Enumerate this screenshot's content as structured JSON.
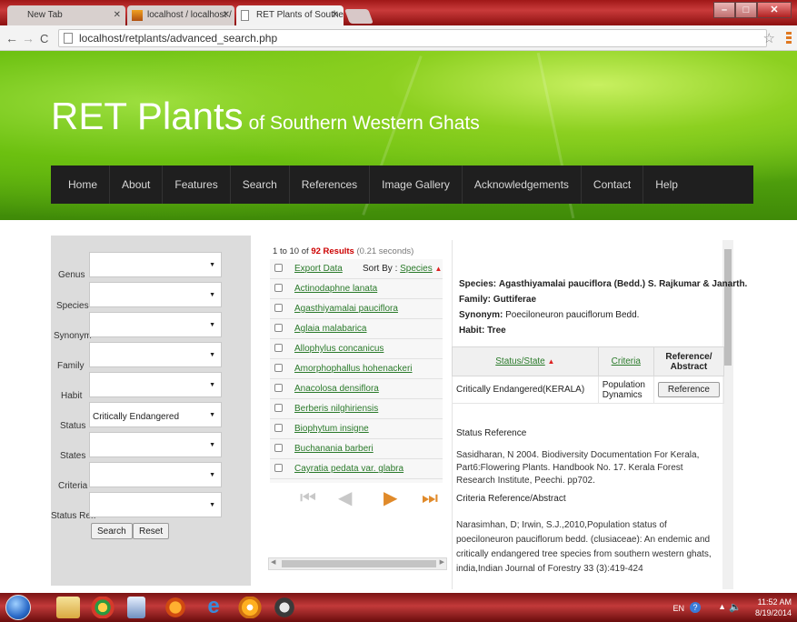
{
  "browser": {
    "tabs": [
      {
        "title": "New Tab"
      },
      {
        "title": "localhost / localhost / retp"
      },
      {
        "title": "RET Plants of Southern We"
      }
    ],
    "url": "localhost/retplants/advanced_search.php"
  },
  "site": {
    "title_big": "RET Plants",
    "title_small": "of Southern Western Ghats",
    "nav": [
      "Home",
      "About",
      "Features",
      "Search",
      "References",
      "Image Gallery",
      "Acknowledgements",
      "Contact",
      "Help"
    ]
  },
  "search": {
    "fields": [
      {
        "label": "Genus",
        "value": ""
      },
      {
        "label": "Species",
        "value": ""
      },
      {
        "label": "Synonym",
        "value": ""
      },
      {
        "label": "Family",
        "value": ""
      },
      {
        "label": "Habit",
        "value": ""
      },
      {
        "label": "Status",
        "value": "Critically Endangered"
      },
      {
        "label": "States",
        "value": ""
      },
      {
        "label": "Criteria",
        "value": ""
      },
      {
        "label": "Status Ref.",
        "value": ""
      }
    ],
    "search_label": "Search",
    "reset_label": "Reset"
  },
  "results": {
    "count_from": "1",
    "count_to_word": "to",
    "count_to": "10",
    "count_of_word": "of",
    "count_total": "92 Results",
    "time": "(0.21 seconds)",
    "export_label": "Export Data",
    "sort_label": "Sort By :",
    "sort_field": "Species",
    "items": [
      "Actinodaphne lanata",
      "Agasthiyamalai pauciflora",
      "Aglaia malabarica",
      "Allophylus concanicus",
      "Amorphophallus hohenackeri",
      "Anacolosa densiflora",
      "Berberis nilghiriensis",
      "Biophytum insigne",
      "Buchanania barberi",
      "Cayratia pedata var. glabra"
    ]
  },
  "detail": {
    "species_label": "Species:",
    "species": "Agasthiyamalai pauciflora (Bedd.) S. Rajkumar & Janarth.",
    "family_label": "Family:",
    "family": "Guttiferae",
    "synonym_label": "Synonym:",
    "synonym": "Poeciloneuron pauciflorum Bedd.",
    "habit_label": "Habit:",
    "habit": "Tree",
    "table_headers": {
      "status": "Status/State",
      "criteria": "Criteria",
      "reference": "Reference/ Abstract"
    },
    "row": {
      "status": "Critically Endangered(KERALA)",
      "criteria": "Population Dynamics",
      "reference_button": "Reference"
    },
    "status_ref_title": "Status Reference",
    "status_ref_text": "Sasidharan, N 2004. Biodiversity Documentation For Kerala, Part6:Flowering Plants. Handbook No. 17. Kerala Forest Research Institute, Peechi. pp702.",
    "criteria_ref_title": "Criteria Reference/Abstract",
    "criteria_ref_text": "Narasimhan, D; Irwin, S.J.,2010,Population status of poeciloneuron pauciflorum bedd. (clusiaceae): An endemic and critically endangered tree species from southern western ghats, india,Indian Journal of Forestry 33 (3):419-424"
  },
  "taskbar": {
    "lang": "EN",
    "time": "11:52 AM",
    "date": "8/19/2014"
  }
}
